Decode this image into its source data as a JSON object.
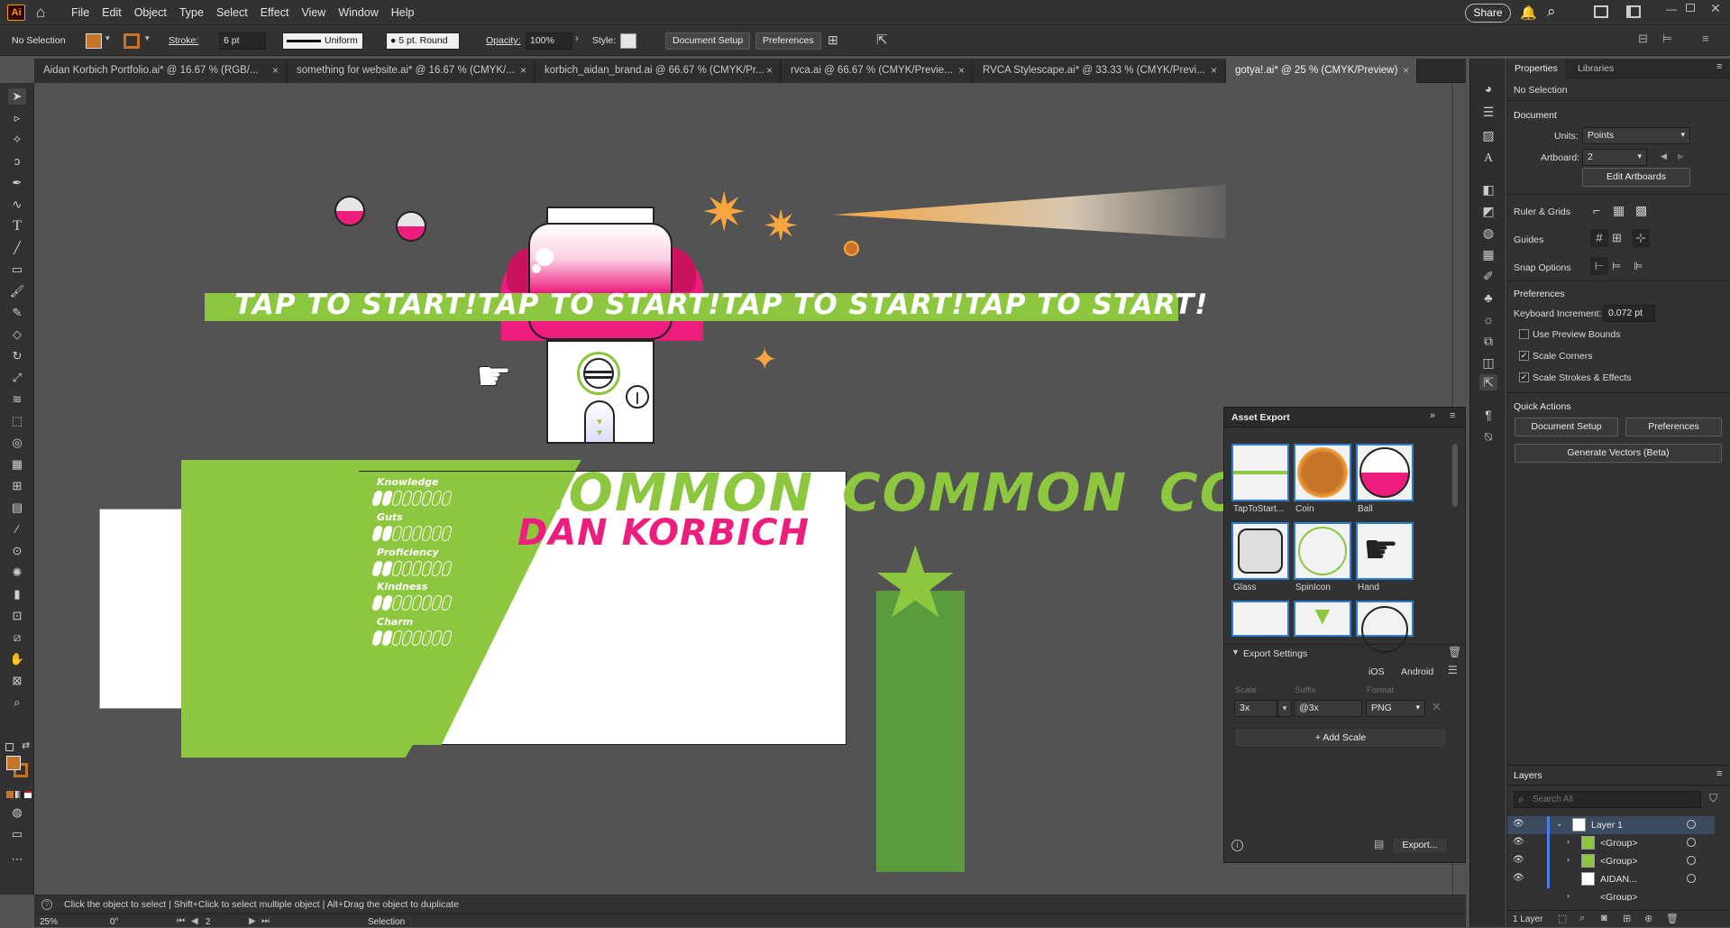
{
  "app": {
    "logo": "Ai",
    "menus": [
      "File",
      "Edit",
      "Object",
      "Type",
      "Select",
      "Effect",
      "View",
      "Window",
      "Help"
    ],
    "share_label": "Share"
  },
  "controlbar": {
    "selection": "No Selection",
    "stroke_label": "Stroke:",
    "stroke_value": "6 pt",
    "stroke_profile": "Uniform",
    "brush": "5 pt. Round",
    "opacity_label": "Opacity:",
    "opacity_value": "100%",
    "style_label": "Style:",
    "document_setup": "Document Setup",
    "preferences": "Preferences"
  },
  "tabs": [
    "Aidan Korbich Portfolio.ai* @ 16.67 % (RGB/...",
    "something for website.ai* @ 16.67 % (CMYK/...",
    "korbich_aidan_brand.ai @ 66.67 % (CMYK/Pr...",
    "rvca.ai @ 66.67 % (CMYK/Previe...",
    "RVCA Stylescape.ai* @ 33.33 % (CMYK/Previ...",
    "gotya!.ai* @ 25 % (CMYK/Preview)"
  ],
  "artwork": {
    "tap_text": "TAP TO START!",
    "common_text": "COMMON",
    "common_partial": "CO",
    "name_text": "DAN KORBICH",
    "stats": [
      "Knowledge",
      "Guts",
      "Proficiency",
      "Kindness",
      "Charm"
    ]
  },
  "asset_export": {
    "title": "Asset Export",
    "assets": [
      "TapToStart...",
      "Coin",
      "Ball",
      "Glass",
      "SpinIcon",
      "Hand"
    ],
    "export_settings": "Export Settings",
    "platforms": [
      "iOS",
      "Android"
    ],
    "scale_label": "Scale",
    "suffix_label": "Suffix",
    "format_label": "Format",
    "scale_value": "3x",
    "suffix_value": "@3x",
    "format_value": "PNG",
    "add_scale": "Add Scale",
    "export_button": "Export..."
  },
  "properties": {
    "tabs": [
      "Properties",
      "Libraries"
    ],
    "selection": "No Selection",
    "document_head": "Document",
    "units_label": "Units:",
    "units_value": "Points",
    "artboard_label": "Artboard:",
    "artboard_value": "2",
    "edit_artboards": "Edit Artboards",
    "ruler_grids": "Ruler & Grids",
    "guides": "Guides",
    "snap_options": "Snap Options",
    "preferences_head": "Preferences",
    "keyboard_increment_label": "Keyboard Increment:",
    "keyboard_increment_value": "0.072 pt",
    "use_preview_bounds": "Use Preview Bounds",
    "scale_corners": "Scale Corners",
    "scale_strokes": "Scale Strokes & Effects",
    "quick_actions": "Quick Actions",
    "document_setup": "Document Setup",
    "preferences": "Preferences",
    "generate_vectors": "Generate Vectors (Beta)"
  },
  "layers": {
    "title": "Layers",
    "search_placeholder": "Search All",
    "rows": [
      "Layer 1",
      "<Group>",
      "<Group>",
      "AIDAN...",
      "<Group>"
    ],
    "footer": "1 Layer"
  },
  "status": {
    "hint": "Click the object to select  |  Shift+Click to select multiple object  |  Alt+Drag the object to duplicate",
    "zoom": "25%",
    "rotation": "0°",
    "artboard": "2",
    "tool": "Selection"
  },
  "colors": {
    "green": "#8dc63f",
    "dark_green": "#5b9b3e",
    "pink": "#ec1d7d",
    "orange": "#f5a640",
    "fill_swatch": "#c87428"
  }
}
